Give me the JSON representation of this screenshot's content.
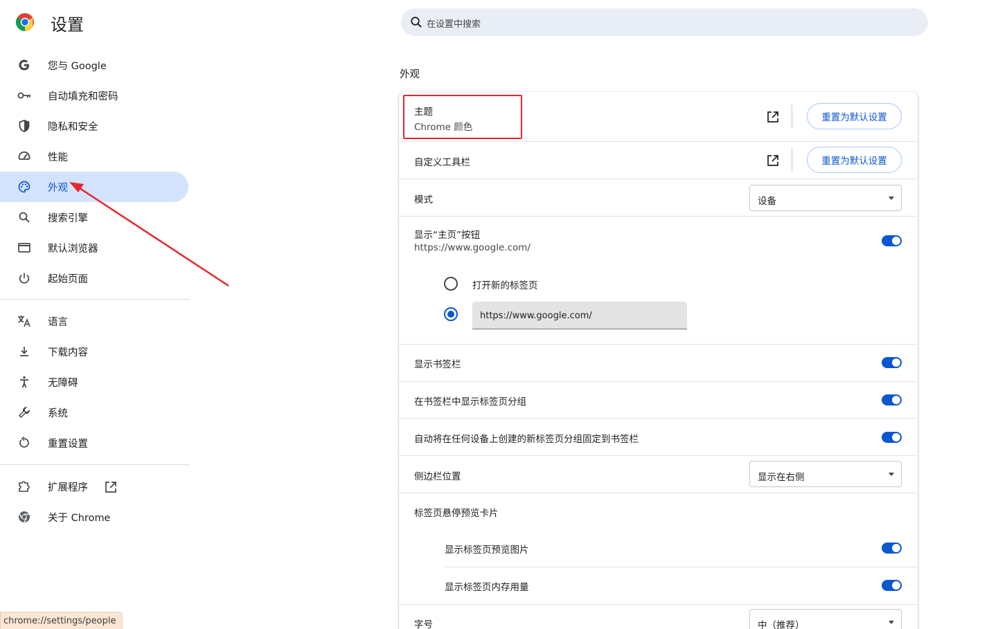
{
  "app": {
    "title": "设置"
  },
  "sidebar": {
    "items": [
      {
        "label": "您与 Google",
        "icon": "google-g-icon"
      },
      {
        "label": "自动填充和密码",
        "icon": "key-icon"
      },
      {
        "label": "隐私和安全",
        "icon": "shield-icon"
      },
      {
        "label": "性能",
        "icon": "speedometer-icon"
      },
      {
        "label": "外观",
        "icon": "palette-icon",
        "active": true
      },
      {
        "label": "搜索引擎",
        "icon": "search-icon"
      },
      {
        "label": "默认浏览器",
        "icon": "browser-window-icon"
      },
      {
        "label": "起始页面",
        "icon": "power-icon"
      },
      {
        "label": "语言",
        "icon": "translate-icon"
      },
      {
        "label": "下载内容",
        "icon": "download-icon"
      },
      {
        "label": "无障碍",
        "icon": "accessibility-icon"
      },
      {
        "label": "系统",
        "icon": "wrench-icon"
      },
      {
        "label": "重置设置",
        "icon": "reset-icon"
      },
      {
        "label": "扩展程序",
        "icon": "puzzle-icon"
      },
      {
        "label": "关于 Chrome",
        "icon": "chrome-icon"
      }
    ]
  },
  "search": {
    "placeholder": "在设置中搜索"
  },
  "section": {
    "title": "外观"
  },
  "appearance": {
    "theme": {
      "label": "主题",
      "sublabel": "Chrome 颜色",
      "reset_label": "重置为默认设置"
    },
    "toolbar": {
      "label": "自定义工具栏",
      "reset_label": "重置为默认设置"
    },
    "mode": {
      "label": "模式",
      "value": "设备"
    },
    "home_button": {
      "label": "显示“主页”按钮",
      "sublabel": "https://www.google.com/",
      "enabled": true,
      "option_new_tab": "打开新的标签页",
      "option_url_value": "https://www.google.com/",
      "selected": "custom_url"
    },
    "bookmarks_bar": {
      "label": "显示书签栏",
      "enabled": true
    },
    "tab_groups_in_bookmarks": {
      "label": "在书签栏中显示标签页分组",
      "enabled": true
    },
    "auto_pin_groups": {
      "label": "自动将在任何设备上创建的新标签页分组固定到书签栏",
      "enabled": true
    },
    "side_panel": {
      "label": "侧边栏位置",
      "value": "显示在右侧"
    },
    "hover_cards": {
      "label": "标签页悬停预览卡片",
      "preview_image": {
        "label": "显示标签页预览图片",
        "enabled": true
      },
      "memory_usage": {
        "label": "显示标签页内存用量",
        "enabled": true
      }
    },
    "font_size": {
      "label": "字号",
      "value": "中（推荐）"
    }
  },
  "status_bar": {
    "url": "chrome://settings/people"
  },
  "colors": {
    "accent": "#0b57d0",
    "active_nav_bg": "#d3e3fd",
    "annotation": "#e8262b",
    "search_bg": "#e9eef6"
  }
}
